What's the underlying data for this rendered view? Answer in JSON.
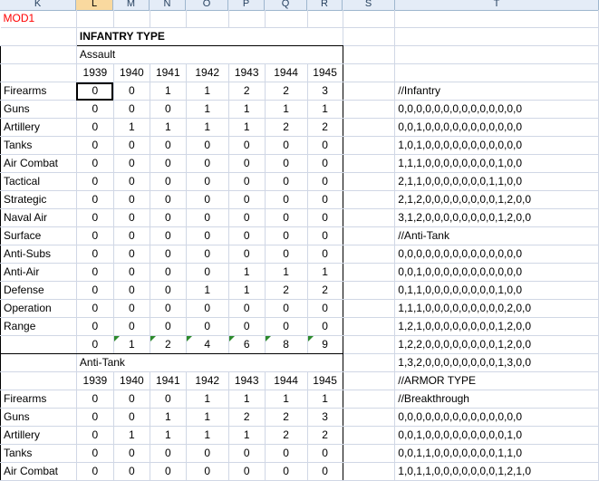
{
  "column_headers": [
    "K",
    "L",
    "M",
    "N",
    "O",
    "P",
    "Q",
    "R",
    "S",
    "T"
  ],
  "selected_column": "L",
  "mod_label": "MOD1",
  "section_title": "INFANTRY TYPE",
  "block1": {
    "label": "Assault",
    "years": [
      "1939",
      "1940",
      "1941",
      "1942",
      "1943",
      "1944",
      "1945"
    ],
    "rows": [
      {
        "label": "Firearms",
        "values": [
          "0",
          "0",
          "1",
          "1",
          "2",
          "2",
          "3"
        ]
      },
      {
        "label": "Guns",
        "values": [
          "0",
          "0",
          "0",
          "1",
          "1",
          "1",
          "1"
        ]
      },
      {
        "label": "Artillery",
        "values": [
          "0",
          "1",
          "1",
          "1",
          "1",
          "2",
          "2"
        ]
      },
      {
        "label": "Tanks",
        "values": [
          "0",
          "0",
          "0",
          "0",
          "0",
          "0",
          "0"
        ]
      },
      {
        "label": "Air Combat",
        "values": [
          "0",
          "0",
          "0",
          "0",
          "0",
          "0",
          "0"
        ]
      },
      {
        "label": "Tactical",
        "values": [
          "0",
          "0",
          "0",
          "0",
          "0",
          "0",
          "0"
        ]
      },
      {
        "label": "Strategic",
        "values": [
          "0",
          "0",
          "0",
          "0",
          "0",
          "0",
          "0"
        ]
      },
      {
        "label": "Naval Air",
        "values": [
          "0",
          "0",
          "0",
          "0",
          "0",
          "0",
          "0"
        ]
      },
      {
        "label": "Surface",
        "values": [
          "0",
          "0",
          "0",
          "0",
          "0",
          "0",
          "0"
        ]
      },
      {
        "label": "Anti-Subs",
        "values": [
          "0",
          "0",
          "0",
          "0",
          "0",
          "0",
          "0"
        ]
      },
      {
        "label": "Anti-Air",
        "values": [
          "0",
          "0",
          "0",
          "0",
          "1",
          "1",
          "1"
        ]
      },
      {
        "label": "Defense",
        "values": [
          "0",
          "0",
          "0",
          "1",
          "1",
          "2",
          "2"
        ]
      },
      {
        "label": "Operation",
        "values": [
          "0",
          "0",
          "0",
          "0",
          "0",
          "0",
          "0"
        ]
      },
      {
        "label": "Range",
        "values": [
          "0",
          "0",
          "0",
          "0",
          "0",
          "0",
          "0"
        ]
      }
    ],
    "totals": [
      "0",
      "1",
      "2",
      "4",
      "6",
      "8",
      "9"
    ]
  },
  "block2": {
    "label": "Anti-Tank",
    "years": [
      "1939",
      "1940",
      "1941",
      "1942",
      "1943",
      "1944",
      "1945"
    ],
    "rows": [
      {
        "label": "Firearms",
        "values": [
          "0",
          "0",
          "0",
          "1",
          "1",
          "1",
          "1"
        ]
      },
      {
        "label": "Guns",
        "values": [
          "0",
          "0",
          "1",
          "1",
          "2",
          "2",
          "3"
        ]
      },
      {
        "label": "Artillery",
        "values": [
          "0",
          "1",
          "1",
          "1",
          "1",
          "2",
          "2"
        ]
      },
      {
        "label": "Tanks",
        "values": [
          "0",
          "0",
          "0",
          "0",
          "0",
          "0",
          "0"
        ]
      },
      {
        "label": "Air Combat",
        "values": [
          "0",
          "0",
          "0",
          "0",
          "0",
          "0",
          "0"
        ]
      }
    ]
  },
  "column_t": [
    "",
    "",
    "",
    "",
    "//Infantry",
    "0,0,0,0,0,0,0,0,0,0,0,0,0,0",
    "0,0,1,0,0,0,0,0,0,0,0,0,0,0",
    "1,0,1,0,0,0,0,0,0,0,0,0,0,0",
    "1,1,1,0,0,0,0,0,0,0,0,1,0,0",
    "2,1,1,0,0,0,0,0,0,0,1,1,0,0",
    "2,1,2,0,0,0,0,0,0,0,0,1,2,0,0",
    "3,1,2,0,0,0,0,0,0,0,0,1,2,0,0",
    "//Anti-Tank",
    "0,0,0,0,0,0,0,0,0,0,0,0,0,0",
    "0,0,1,0,0,0,0,0,0,0,0,0,0,0",
    "0,1,1,0,0,0,0,0,0,0,0,1,0,0",
    "1,1,1,0,0,0,0,0,0,0,0,0,2,0,0",
    "1,2,1,0,0,0,0,0,0,0,0,1,2,0,0",
    "1,2,2,0,0,0,0,0,0,0,0,1,2,0,0",
    "1,3,2,0,0,0,0,0,0,0,0,1,3,0,0",
    "//ARMOR TYPE",
    "//Breakthrough",
    "0,0,0,0,0,0,0,0,0,0,0,0,0,0",
    "0,0,1,0,0,0,0,0,0,0,0,0,1,0",
    "0,0,1,1,0,0,0,0,0,0,0,1,1,0",
    "1,0,1,1,0,0,0,0,0,0,0,1,2,1,0",
    "1,1,1,2,0,0,0,0,0,0,0,1,2,1,0"
  ]
}
